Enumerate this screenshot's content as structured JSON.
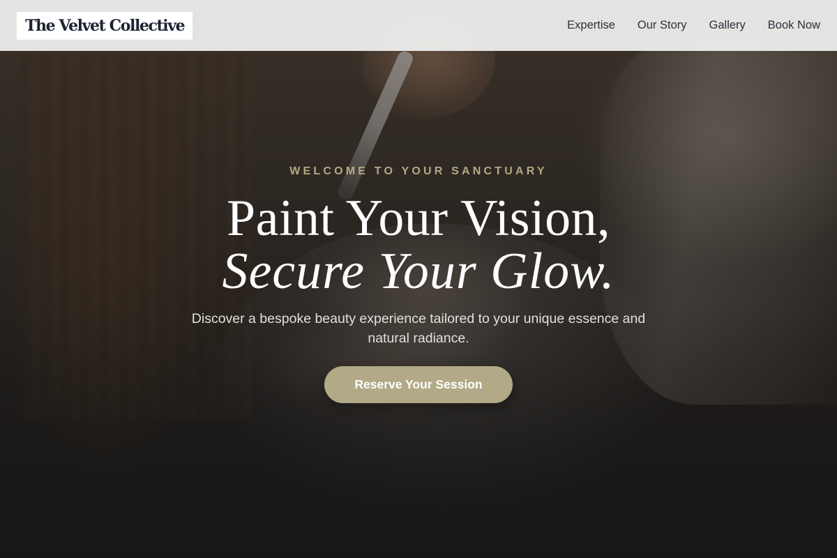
{
  "header": {
    "logo_text": "The Velvet Collective",
    "nav": [
      {
        "label": "Expertise"
      },
      {
        "label": "Our Story"
      },
      {
        "label": "Gallery"
      },
      {
        "label": "Book Now"
      }
    ]
  },
  "hero": {
    "eyebrow": "WELCOME TO YOUR SANCTUARY",
    "headline_line1": "Paint Your Vision,",
    "headline_line2": "Secure Your Glow.",
    "subtitle": "Discover a bespoke beauty experience tailored to your unique essence and natural radiance.",
    "cta_label": "Reserve Your Session",
    "background_image": "makeup-brush-facial-photo-icon"
  },
  "colors": {
    "accent": "#b2aa86",
    "eyebrow": "#b3a985",
    "header_bg": "#f3f3f2",
    "logo_text": "#1c2331",
    "nav_text": "#2b2f38"
  }
}
